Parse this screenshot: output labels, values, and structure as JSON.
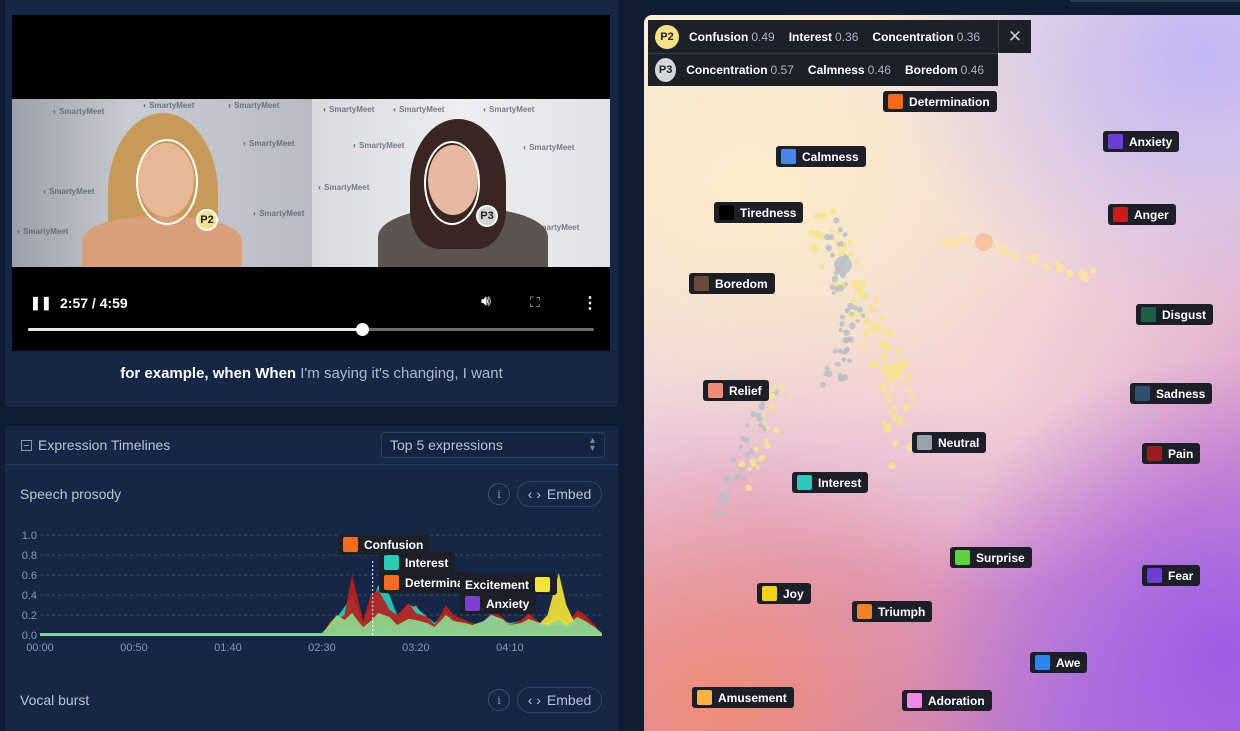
{
  "player": {
    "time": "2:57 / 4:59",
    "progress": 0.59,
    "watermark": "SmartyMeet",
    "participants": [
      {
        "id": "P2",
        "color": "#f7e08a"
      },
      {
        "id": "P3",
        "color": "#d4d4d4"
      }
    ]
  },
  "caption": {
    "spoken": "for example, when When",
    "pending": " I'm saying it's changing, I want"
  },
  "timelines": {
    "title": "Expression Timelines",
    "select_value": "Top 5 expressions",
    "sections": [
      {
        "title": "Speech prosody",
        "info": "i",
        "embed": "Embed"
      },
      {
        "title": "Vocal burst",
        "info": "i",
        "embed": "Embed"
      }
    ]
  },
  "chart_data": {
    "type": "area",
    "title": "Speech prosody",
    "xlabel": "",
    "ylabel": "",
    "ylim": [
      0,
      1.0
    ],
    "y_ticks": [
      "1.0",
      "0.8",
      "0.6",
      "0.4",
      "0.2",
      "0.0"
    ],
    "x_ticks": [
      "00:00",
      "00:50",
      "01:40",
      "02:30",
      "03:20",
      "04:10"
    ],
    "xlim_seconds": [
      0,
      299
    ],
    "cursor_seconds": 177,
    "grid": true,
    "series": [
      {
        "name": "Confusion",
        "color": "#f36c21",
        "x": [
          0,
          150,
          154,
          158,
          162,
          166,
          170,
          172,
          176,
          180,
          186,
          190,
          196,
          200,
          206,
          210,
          216,
          220,
          226,
          230,
          236,
          240,
          246,
          250,
          256,
          260,
          266,
          270,
          276,
          280,
          286,
          290,
          295,
          299
        ],
        "values": [
          0,
          0,
          0.12,
          0.2,
          0.1,
          0.15,
          0.2,
          0.1,
          0.15,
          0.35,
          0.2,
          0.12,
          0.18,
          0.3,
          0.12,
          0.1,
          0.2,
          0.12,
          0.15,
          0.08,
          0.1,
          0.2,
          0.12,
          0.1,
          0.14,
          0.2,
          0.1,
          0.12,
          0.18,
          0.12,
          0.22,
          0.15,
          0.1,
          0
        ]
      },
      {
        "name": "Interest",
        "color": "#2bc9b8",
        "x": [
          0,
          150,
          154,
          158,
          162,
          166,
          170,
          172,
          176,
          180,
          186,
          190,
          196,
          200,
          206,
          210,
          216,
          220,
          226,
          230,
          236,
          240,
          246,
          250,
          256,
          260,
          266,
          270,
          276,
          280,
          286,
          290,
          295,
          299
        ],
        "values": [
          0,
          0,
          0.05,
          0.18,
          0.28,
          0.4,
          0.22,
          0.12,
          0.3,
          0.5,
          0.4,
          0.2,
          0.3,
          0.28,
          0.18,
          0.12,
          0.24,
          0.16,
          0.14,
          0.1,
          0.12,
          0.2,
          0.15,
          0.12,
          0.14,
          0.16,
          0.12,
          0.1,
          0.14,
          0.1,
          0.18,
          0.14,
          0.08,
          0
        ]
      },
      {
        "name": "Determination",
        "color": "#b52020",
        "x": [
          0,
          150,
          154,
          158,
          162,
          166,
          170,
          172,
          176,
          180,
          186,
          190,
          196,
          200,
          206,
          210,
          216,
          220,
          226,
          230,
          236,
          240,
          246,
          250,
          256,
          260,
          266,
          270,
          276,
          280,
          286,
          290,
          295,
          299
        ],
        "values": [
          0,
          0,
          0.08,
          0.15,
          0.2,
          0.6,
          0.3,
          0.15,
          0.4,
          0.45,
          0.25,
          0.2,
          0.32,
          0.22,
          0.18,
          0.1,
          0.3,
          0.2,
          0.15,
          0.12,
          0.1,
          0.25,
          0.18,
          0.1,
          0.15,
          0.22,
          0.12,
          0.1,
          0.15,
          0.1,
          0.25,
          0.2,
          0.1,
          0
        ]
      },
      {
        "name": "Excitement",
        "color": "#f2e23a",
        "x": [
          0,
          150,
          154,
          158,
          162,
          166,
          170,
          172,
          176,
          180,
          186,
          190,
          196,
          200,
          206,
          210,
          216,
          220,
          226,
          230,
          236,
          240,
          246,
          250,
          256,
          260,
          266,
          270,
          276,
          280,
          286,
          290,
          295,
          299
        ],
        "values": [
          0,
          0,
          0.02,
          0.05,
          0.04,
          0.06,
          0.05,
          0.03,
          0.05,
          0.08,
          0.06,
          0.04,
          0.06,
          0.05,
          0.04,
          0.03,
          0.05,
          0.04,
          0.03,
          0.03,
          0.04,
          0.05,
          0.04,
          0.03,
          0.04,
          0.05,
          0.12,
          0.2,
          0.62,
          0.3,
          0.06,
          0.04,
          0.03,
          0
        ]
      },
      {
        "name": "Anxiety",
        "color": "#7b3fd1",
        "x": [
          0,
          150,
          154,
          158,
          162,
          166,
          170,
          172,
          176,
          180,
          186,
          190,
          196,
          200,
          206,
          210,
          216,
          220,
          226,
          230,
          236,
          240,
          246,
          250,
          256,
          260,
          266,
          270,
          276,
          280,
          286,
          290,
          295,
          299
        ],
        "values": [
          0,
          0,
          0.04,
          0.06,
          0.05,
          0.08,
          0.06,
          0.05,
          0.07,
          0.1,
          0.08,
          0.06,
          0.1,
          0.12,
          0.08,
          0.06,
          0.12,
          0.1,
          0.08,
          0.06,
          0.12,
          0.22,
          0.14,
          0.08,
          0.1,
          0.12,
          0.1,
          0.08,
          0.1,
          0.08,
          0.12,
          0.1,
          0.06,
          0
        ]
      },
      {
        "name": "Calmness",
        "color": "#8ed98a",
        "x": [
          0,
          150,
          154,
          158,
          162,
          166,
          170,
          172,
          176,
          180,
          186,
          190,
          196,
          200,
          206,
          210,
          216,
          220,
          226,
          230,
          236,
          240,
          246,
          250,
          256,
          260,
          266,
          270,
          276,
          280,
          286,
          290,
          295,
          299
        ],
        "values": [
          0.02,
          0.02,
          0.1,
          0.2,
          0.15,
          0.22,
          0.12,
          0.08,
          0.14,
          0.22,
          0.18,
          0.1,
          0.16,
          0.15,
          0.12,
          0.08,
          0.2,
          0.14,
          0.12,
          0.1,
          0.14,
          0.2,
          0.16,
          0.1,
          0.12,
          0.16,
          0.12,
          0.1,
          0.16,
          0.1,
          0.18,
          0.14,
          0.08,
          0.02
        ]
      }
    ],
    "tooltip": [
      {
        "label": "Confusion",
        "color": "#f36c21"
      },
      {
        "label": "Interest",
        "color": "#2bc9b8"
      },
      {
        "label": "Determina",
        "color": "#f36c21"
      },
      {
        "label": "Excitement",
        "color": "#f2e23a"
      },
      {
        "label": "Anxiety",
        "color": "#7b3fd1"
      }
    ]
  },
  "popup": {
    "rows": [
      {
        "id": "P2",
        "color": "#f7e08a",
        "items": [
          {
            "label": "Confusion",
            "score": "0.49"
          },
          {
            "label": "Interest",
            "score": "0.36"
          },
          {
            "label": "Concentration",
            "score": "0.36"
          }
        ]
      },
      {
        "id": "P3",
        "color": "#d6d6d6",
        "items": [
          {
            "label": "Concentration",
            "score": "0.57"
          },
          {
            "label": "Calmness",
            "score": "0.46"
          },
          {
            "label": "Boredom",
            "score": "0.46"
          }
        ]
      }
    ],
    "close": "✕"
  },
  "emotion_map": {
    "labels": [
      {
        "label": "Determination",
        "color": "#f26a1b"
      },
      {
        "label": "Anxiety",
        "color": "#6b3fd6"
      },
      {
        "label": "Calmness",
        "color": "#4a86e8"
      },
      {
        "label": "Tiredness",
        "color": "#000000"
      },
      {
        "label": "Anger",
        "color": "#c81d1d"
      },
      {
        "label": "Boredom",
        "color": "#6b4a3a"
      },
      {
        "label": "Disgust",
        "color": "#1e5e45"
      },
      {
        "label": "Relief",
        "color": "#f08a78"
      },
      {
        "label": "Sadness",
        "color": "#2f4f6f"
      },
      {
        "label": "Neutral",
        "color": "#9aa2ad"
      },
      {
        "label": "Pain",
        "color": "#9b1c1c"
      },
      {
        "label": "Interest",
        "color": "#2fc7b9"
      },
      {
        "label": "Surprise",
        "color": "#5fd13f"
      },
      {
        "label": "Fear",
        "color": "#6d3fcf"
      },
      {
        "label": "Joy",
        "color": "#f2d21a"
      },
      {
        "label": "Triumph",
        "color": "#f0822a"
      },
      {
        "label": "Awe",
        "color": "#2e84f0"
      },
      {
        "label": "Amusement",
        "color": "#f7b24a"
      },
      {
        "label": "Adoration",
        "color": "#f08ae6"
      }
    ]
  }
}
